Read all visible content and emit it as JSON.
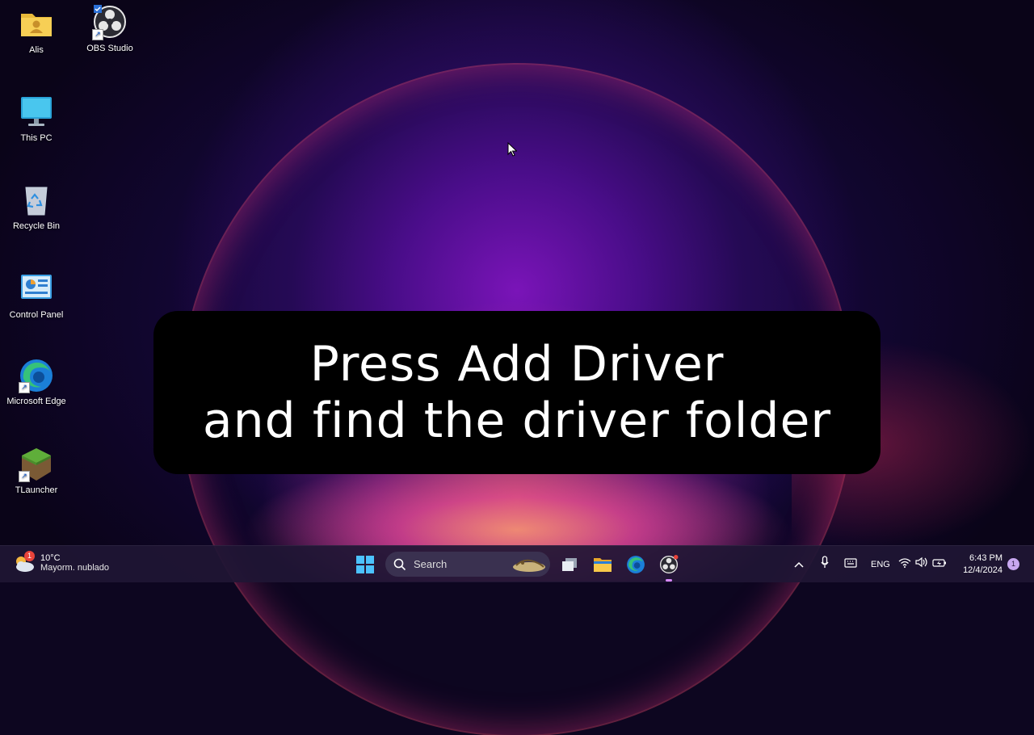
{
  "desktop": {
    "icons": [
      {
        "label": "Alis",
        "icon": "user-folder-icon"
      },
      {
        "label": "OBS Studio",
        "icon": "obs-studio-icon"
      },
      {
        "label": "This PC",
        "icon": "monitor-icon"
      },
      {
        "label": "Recycle Bin",
        "icon": "recycle-bin-icon"
      },
      {
        "label": "Control Panel",
        "icon": "control-panel-icon"
      },
      {
        "label": "Microsoft Edge",
        "icon": "edge-icon"
      },
      {
        "label": "TLauncher",
        "icon": "minecraft-block-icon"
      }
    ]
  },
  "overlay": {
    "line1": "Press Add Driver",
    "line2": "and find the driver folder"
  },
  "taskbar": {
    "weather": {
      "badge": "1",
      "temperature": "10°C",
      "description": "Mayorm. nublado"
    },
    "search_placeholder": "Search",
    "tray": {
      "language": "ENG"
    },
    "clock": {
      "time": "6:43 PM",
      "date": "12/4/2024"
    },
    "notification_count": "1"
  },
  "colors": {
    "taskbar_bg": "#201634",
    "accent": "#0078d4",
    "overlay_bg": "#000000"
  }
}
